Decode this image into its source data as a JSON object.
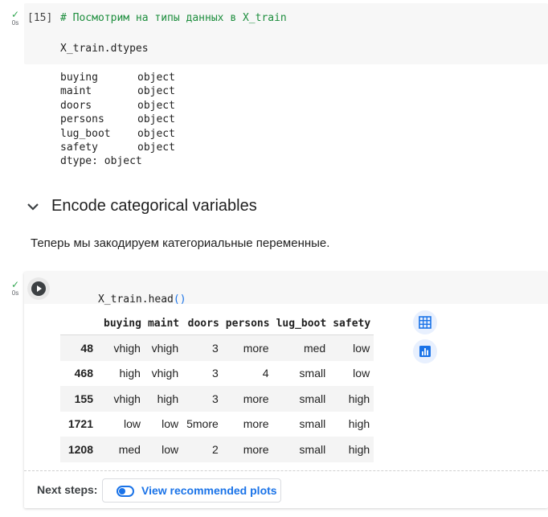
{
  "cell1": {
    "status_time": "0s",
    "execution_count": "[15]",
    "comment_line": "# Посмотрим на типы данных в X_train",
    "code_line": "X_train.dtypes",
    "output_rows": [
      {
        "name": "buying",
        "dtype": "object"
      },
      {
        "name": "maint",
        "dtype": "object"
      },
      {
        "name": "doors",
        "dtype": "object"
      },
      {
        "name": "persons",
        "dtype": "object"
      },
      {
        "name": "lug_boot",
        "dtype": "object"
      },
      {
        "name": "safety",
        "dtype": "object"
      }
    ],
    "output_footer": "dtype: object"
  },
  "section": {
    "heading": "Encode categorical variables",
    "paragraph": "Теперь мы закодируем категориальные переменные."
  },
  "cell2": {
    "status_time": "0s",
    "code_prefix": "X_train.head",
    "code_parens": "()",
    "table": {
      "columns": [
        "buying",
        "maint",
        "doors",
        "persons",
        "lug_boot",
        "safety"
      ],
      "rows": [
        {
          "index": "48",
          "values": [
            "vhigh",
            "vhigh",
            "3",
            "more",
            "med",
            "low"
          ]
        },
        {
          "index": "468",
          "values": [
            "high",
            "vhigh",
            "3",
            "4",
            "small",
            "low"
          ]
        },
        {
          "index": "155",
          "values": [
            "vhigh",
            "high",
            "3",
            "more",
            "small",
            "high"
          ]
        },
        {
          "index": "1721",
          "values": [
            "low",
            "low",
            "5more",
            "more",
            "small",
            "high"
          ]
        },
        {
          "index": "1208",
          "values": [
            "med",
            "low",
            "2",
            "more",
            "small",
            "high"
          ]
        }
      ]
    },
    "next_steps_label": "Next steps:",
    "view_plots_label": "View recommended plots"
  },
  "icons": {
    "status": "check-icon",
    "collapse": "chevron-down-icon",
    "run": "play-icon",
    "table_view": "table-icon",
    "chart_view": "bar-chart-icon",
    "toggle": "toggle-icon"
  },
  "colors": {
    "accent": "#1a73e8",
    "success": "#34a853",
    "comment": "#1e8e3e"
  }
}
